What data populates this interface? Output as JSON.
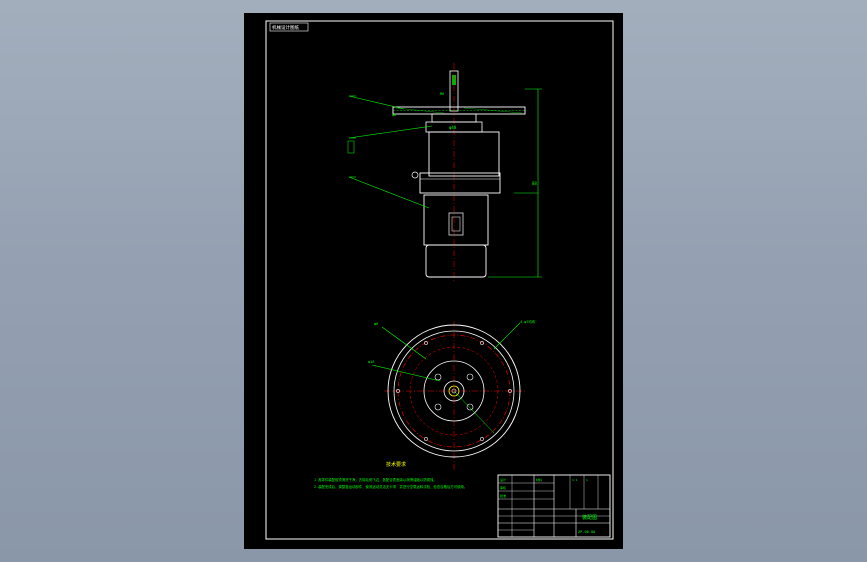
{
  "colors": {
    "background": "#95a1b2",
    "sheet": "#000000",
    "lines": "#ffffff",
    "dimension": "#00ff00",
    "center_line": "#ff0000"
  },
  "drawing": {
    "label_top_left": "机械设计图纸",
    "dims": {
      "flange_left": "φ8",
      "flange_mid": "M6",
      "neck": "φ40",
      "height": "88",
      "bolt_circle": "4-φ7均布",
      "inner_hole": "φ16",
      "hole_label": "φ6"
    },
    "notes": {
      "heading": "技术要求",
      "line1": "1.各零件装配前须清洗干净，去除毛刺飞边，各配合表面涂以润滑油脂以防锈蚀。",
      "line2": "2.装配完成后，调整各运动部件，使其运动灵活无卡滞，并进行空载运转试验，检查合格后方可使用。"
    },
    "title_block": {
      "title": "装配图",
      "code": "ZP-00-00",
      "scale": "1:1",
      "sheet": "1",
      "designer": "设计",
      "checker": "审核",
      "approver": "批准",
      "material": "材料"
    }
  }
}
